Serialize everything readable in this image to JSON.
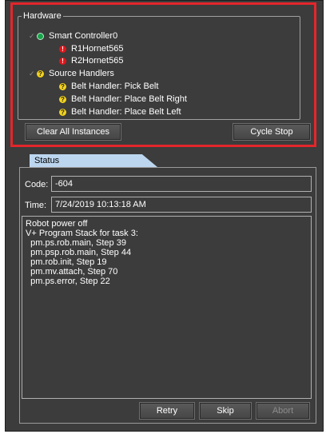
{
  "hardware": {
    "legend": "Hardware",
    "items": [
      {
        "label": "Smart Controller0",
        "icon": "green-status-icon"
      },
      {
        "label": "R1Hornet565",
        "icon": "red-error-icon"
      },
      {
        "label": "R2Hornet565",
        "icon": "red-error-icon"
      },
      {
        "label": "Source Handlers",
        "icon": "yellow-warning-icon"
      },
      {
        "label": "Belt Handler: Pick Belt",
        "icon": "yellow-warning-icon"
      },
      {
        "label": "Belt Handler: Place Belt Right",
        "icon": "yellow-warning-icon"
      },
      {
        "label": "Belt Handler: Place Belt Left",
        "icon": "yellow-warning-icon"
      }
    ],
    "clear_button": "Clear All Instances",
    "cycle_stop_button": "Cycle Stop"
  },
  "status": {
    "tab_label": "Status",
    "code_label": "Code:",
    "code_value": "-604",
    "time_label": "Time:",
    "time_value": "7/24/2019 10:13:18 AM",
    "message_lines": [
      "Robot power off",
      "",
      "V+ Program Stack for task 3:",
      "  pm.ps.rob.main, Step 39",
      "  pm.psp.rob.main, Step 44",
      "  pm.rob.init, Step 19",
      "  pm.mv.attach, Step 70",
      "  pm.ps.error, Step 22"
    ]
  },
  "actions": {
    "retry": "Retry",
    "skip": "Skip",
    "abort": "Abort"
  },
  "colors": {
    "highlight": "#e3262b",
    "panel_bg": "#3c3c3c",
    "tab_bg": "#bcd6ef",
    "ok": "#17a34a",
    "error": "#e0151a",
    "warning": "#f2d21b"
  }
}
